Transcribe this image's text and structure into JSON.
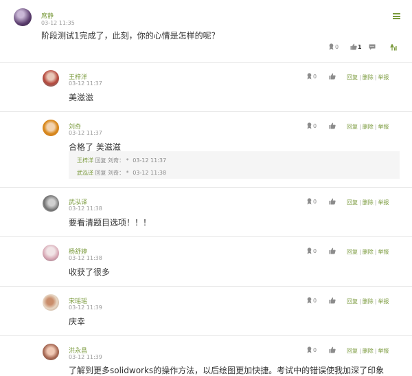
{
  "post": {
    "author": "席静",
    "time": "03-12 11:35",
    "content": "阶段测试1完成了，此刻，你的心情是怎样的呢？",
    "award_count": "0",
    "like_count": "1"
  },
  "replies": [
    {
      "author": "王梓洋",
      "time": "03-12 11:37",
      "content": "美滋滋",
      "award_count": "0"
    },
    {
      "author": "刘奇",
      "time": "03-12 11:37",
      "content": "合格了 美滋滋",
      "award_count": "0",
      "subreplies": [
        {
          "author": "王梓洋",
          "verb": "回复",
          "target": "刘奇：",
          "text": "*",
          "time": "03-12 11:37"
        },
        {
          "author": "武泓译",
          "verb": "回复",
          "target": "刘奇：",
          "text": "*",
          "time": "03-12 11:38"
        }
      ]
    },
    {
      "author": "武泓译",
      "time": "03-12 11:38",
      "content": "要看清题目选项！！！",
      "award_count": "0"
    },
    {
      "author": "杨舒婷",
      "time": "03-12 11:38",
      "content": "收获了很多",
      "award_count": "0"
    },
    {
      "author": "宋瑶瑶",
      "time": "03-12 11:39",
      "content": "庆幸",
      "award_count": "0"
    },
    {
      "author": "洪永昌",
      "time": "03-12 11:39",
      "content": "了解到更多solidworks的操作方法，以后绘图更加快捷。考试中的错误使我加深了印象",
      "award_count": "0"
    }
  ],
  "actions": {
    "reply": "回复",
    "delete": "删除",
    "report": "举报",
    "sep": "|"
  },
  "icons": {
    "award": "award-icon",
    "like": "thumbs-up-icon",
    "comment": "comment-icon",
    "menu": "hamburger-menu-icon",
    "top": "top-arrow-icon"
  },
  "colors": {
    "accent": "#7a9a3c",
    "divider": "#e6e6e6",
    "muted": "#9a9a9a"
  }
}
